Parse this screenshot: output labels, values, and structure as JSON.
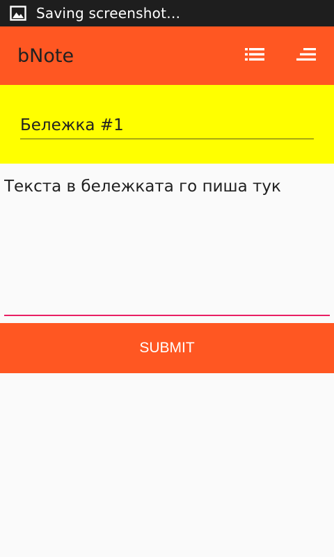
{
  "status_bar": {
    "icon": "image-icon",
    "text": "Saving screenshot…"
  },
  "app_bar": {
    "title": "bNote",
    "actions": [
      {
        "icon": "list-icon"
      },
      {
        "icon": "sort-icon"
      }
    ]
  },
  "note": {
    "title_value": "Бележка #1",
    "body_value": "Текста в бележката го пиша тук"
  },
  "submit": {
    "label": "SUBMIT"
  },
  "colors": {
    "status_bar": "#1e1e1e",
    "app_bar": "#ff5722",
    "title_area": "#ffff00",
    "background": "#fafafa",
    "accent_underline": "#e91e63",
    "submit_button": "#ff5722"
  }
}
